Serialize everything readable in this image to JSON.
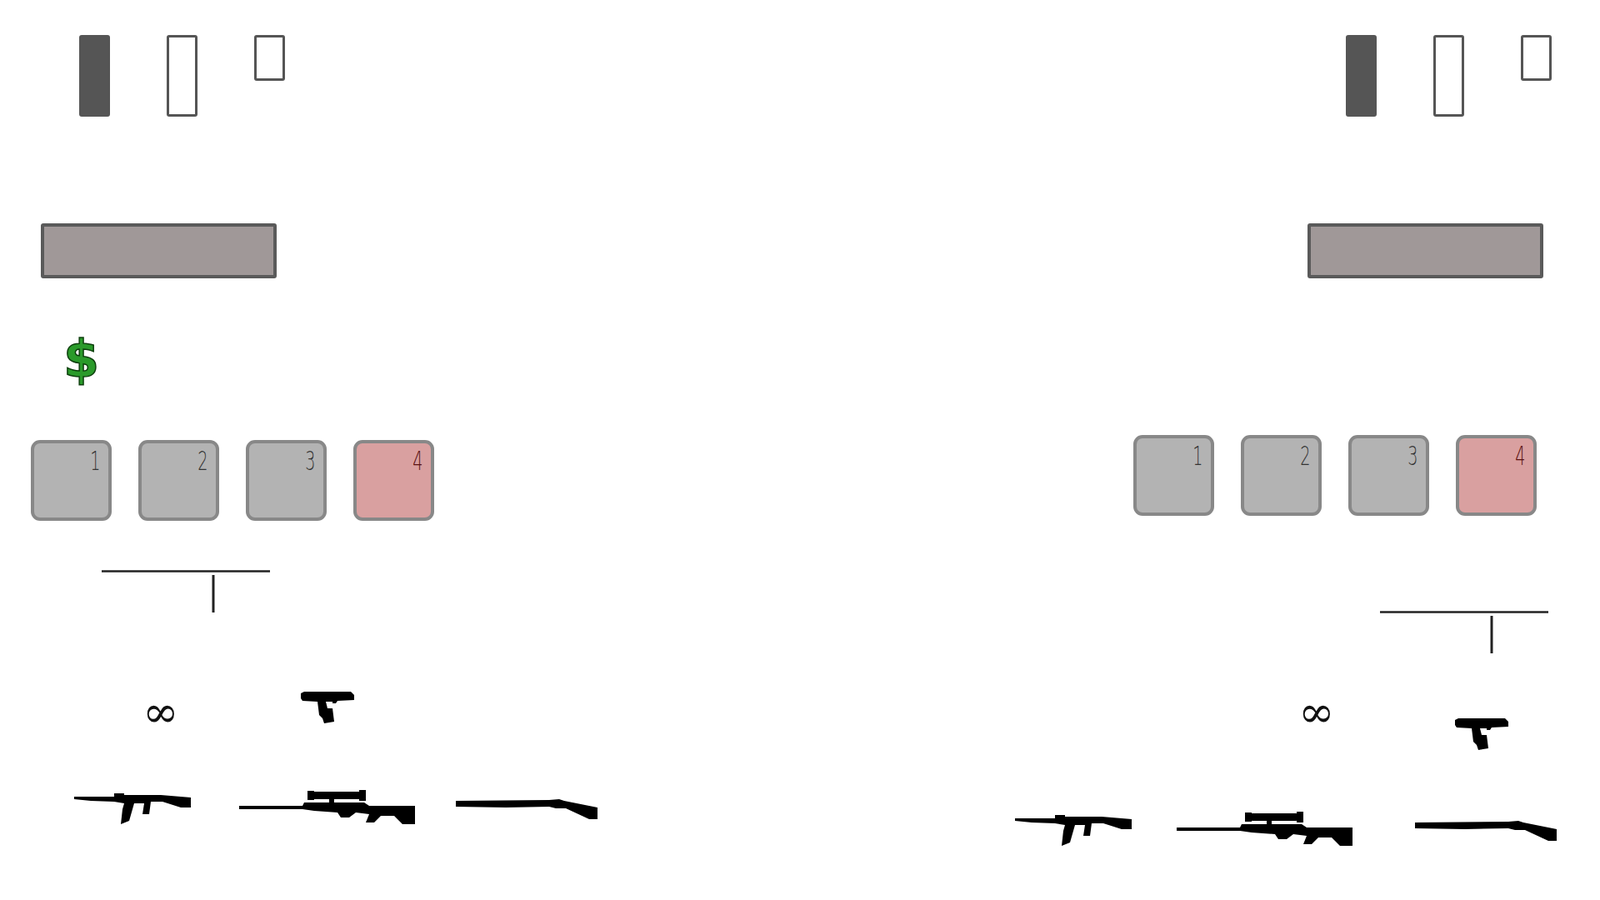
{
  "players": [
    {
      "slots": [
        {
          "filled": true
        },
        {
          "filled": false
        },
        {
          "filled": false
        }
      ],
      "money": "$",
      "keys": [
        {
          "label": "1",
          "selected": false
        },
        {
          "label": "2",
          "selected": false
        },
        {
          "label": "3",
          "selected": false
        },
        {
          "label": "4",
          "selected": true
        }
      ],
      "ammo": "∞"
    },
    {
      "slots": [
        {
          "filled": true
        },
        {
          "filled": false
        },
        {
          "filled": false
        }
      ],
      "keys": [
        {
          "label": "1",
          "selected": false
        },
        {
          "label": "2",
          "selected": false
        },
        {
          "label": "3",
          "selected": false
        },
        {
          "label": "4",
          "selected": true
        }
      ],
      "ammo": "∞"
    }
  ]
}
